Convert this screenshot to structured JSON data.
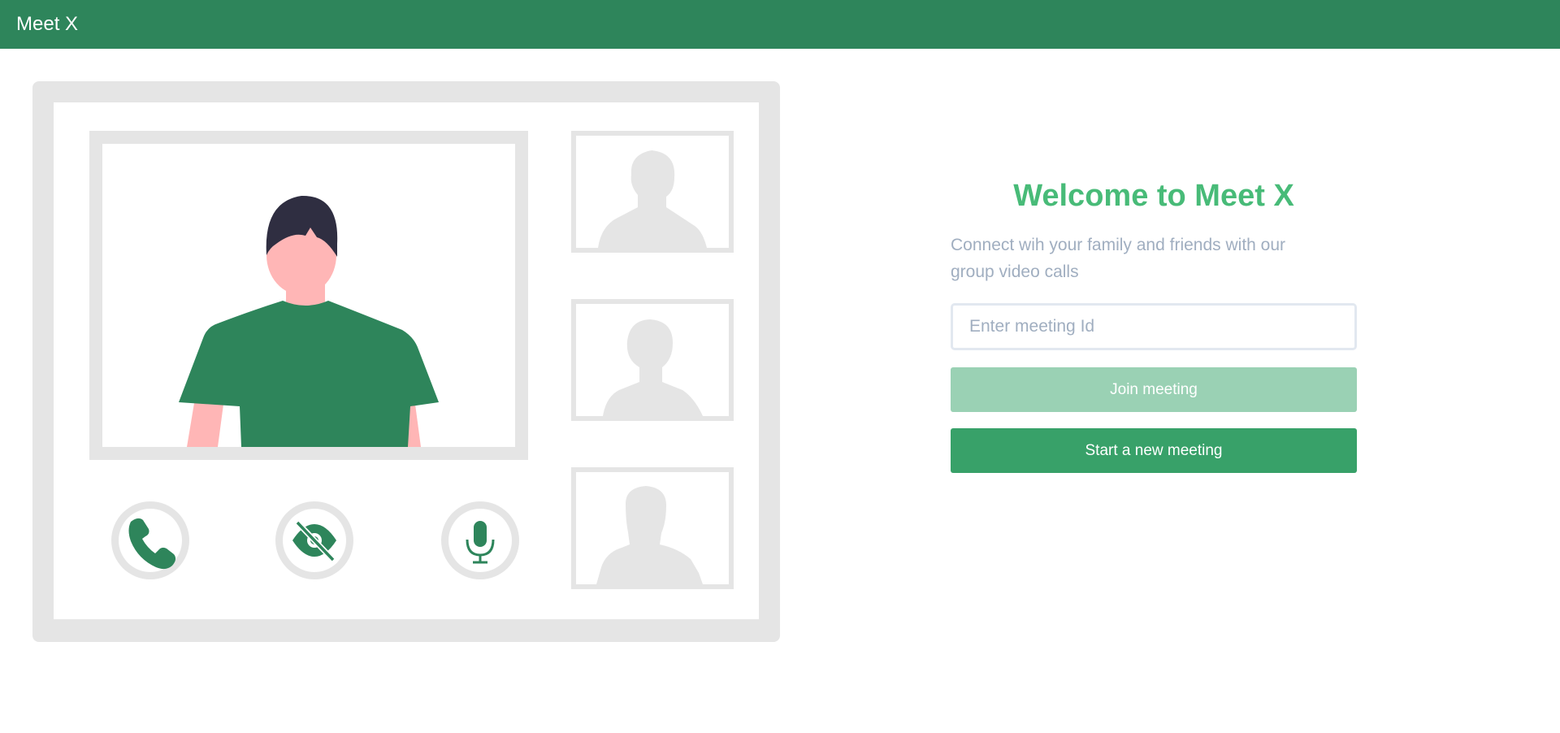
{
  "header": {
    "brand": "Meet X",
    "color": "#2e855b"
  },
  "illustration": {
    "icons": [
      "phone-icon",
      "eye-slash-icon",
      "microphone-icon"
    ]
  },
  "panel": {
    "title": "Welcome to Meet X",
    "subtitle": "Connect wih your family and friends with our group video calls",
    "input_placeholder": "Enter meeting Id",
    "input_value": "",
    "join_label": "Join meeting",
    "start_label": "Start a new meeting",
    "accent_color": "#48bb78",
    "join_color": "#9ad1b4",
    "start_color": "#38a169"
  }
}
